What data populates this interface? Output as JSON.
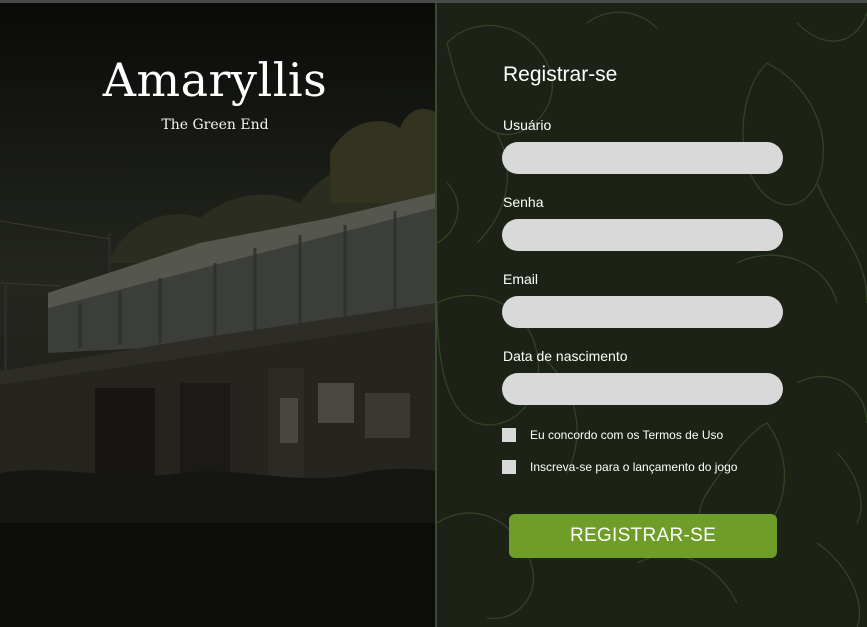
{
  "brand": {
    "title": "Amaryllis",
    "subtitle": "The Green End"
  },
  "background_image": {
    "icon": "abandoned-building-image"
  },
  "form": {
    "title": "Registrar-se",
    "fields": [
      {
        "label": "Usuário",
        "value": "",
        "placeholder": ""
      },
      {
        "label": "Senha",
        "value": "",
        "placeholder": ""
      },
      {
        "label": "Email",
        "value": "",
        "placeholder": ""
      },
      {
        "label": "Data de nascimento",
        "value": "",
        "placeholder": ""
      }
    ],
    "checkboxes": [
      {
        "label": "Eu concordo com os Termos de Uso",
        "checked": false
      },
      {
        "label": "Inscreva-se para o lançamento do jogo",
        "checked": false
      }
    ],
    "submit_label": "REGISTRAR-SE"
  },
  "colors": {
    "panel_background": "#1c2316",
    "input_background": "#d9d9d9",
    "button_accent": "#6e9e27"
  }
}
